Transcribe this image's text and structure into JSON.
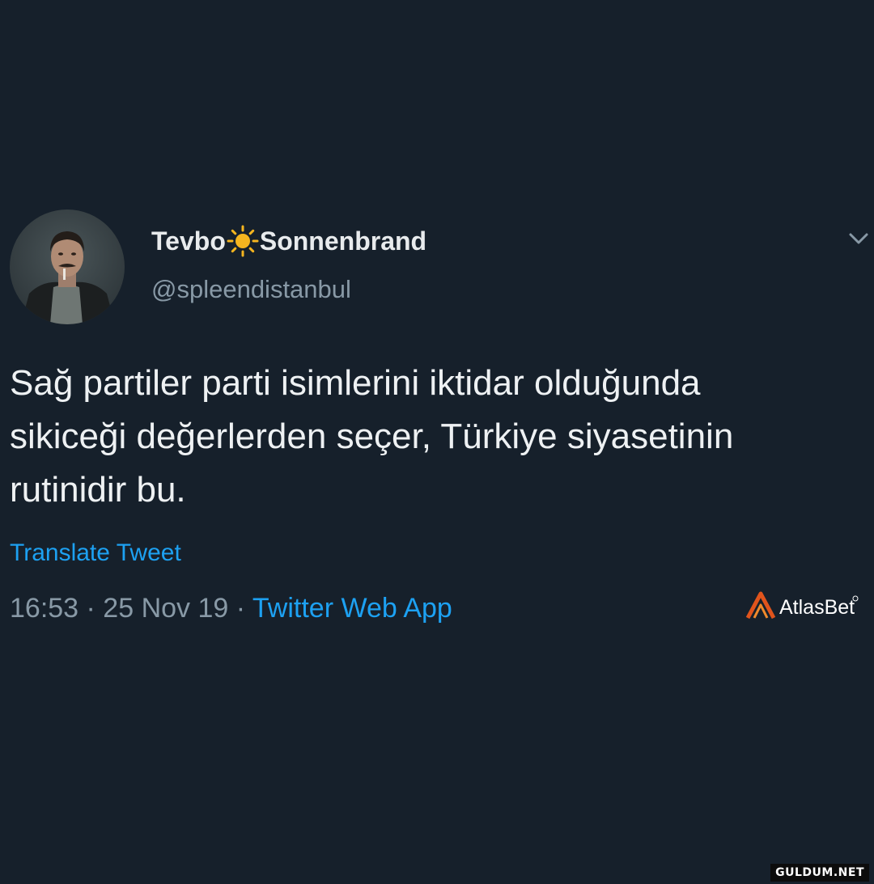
{
  "tweet": {
    "author": {
      "name_part1": "Tevbo",
      "name_emoji": "sun-emoji",
      "name_part2": "Sonnenbrand",
      "handle": "@spleendistanbul",
      "avatar_icon": "profile-photo"
    },
    "menu_icon": "chevron-down-icon",
    "text": "Sağ partiler parti isimlerini iktidar olduğunda\nsikiceği değerlerden seçer, Türkiye siyasetinin\nrutinidir bu.",
    "translate_label": "Translate Tweet",
    "timestamp": "16:53 · 25 Nov 19 · ",
    "source": "Twitter Web App"
  },
  "overlays": {
    "atlas_logo_text": "AtlasBet",
    "watermark": "GULDUM.NET"
  },
  "colors": {
    "background": "#16202b",
    "link": "#1da1f2",
    "muted": "#8899a6",
    "text": "#eef1f3",
    "logo_accent": "#e0541c"
  }
}
